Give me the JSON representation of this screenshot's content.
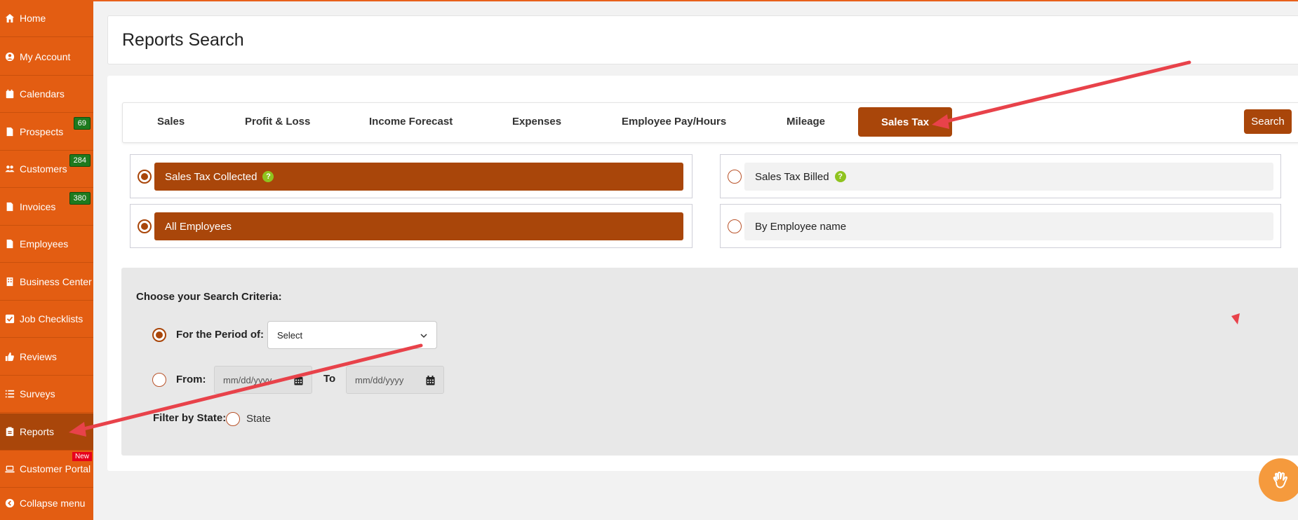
{
  "sidebar": {
    "items": [
      {
        "label": "Home",
        "icon": "home-icon"
      },
      {
        "label": "My Account",
        "icon": "user-circle-icon"
      },
      {
        "label": "Calendars",
        "icon": "calendar-icon"
      },
      {
        "label": "Prospects",
        "icon": "file-icon",
        "badge": "69"
      },
      {
        "label": "Customers",
        "icon": "users-icon",
        "badge": "284"
      },
      {
        "label": "Invoices",
        "icon": "file-icon",
        "badge": "380"
      },
      {
        "label": "Employees",
        "icon": "file-icon"
      },
      {
        "label": "Business Center",
        "icon": "building-icon"
      },
      {
        "label": "Job Checklists",
        "icon": "checkbox-icon"
      },
      {
        "label": "Reviews",
        "icon": "thumbs-up-icon"
      },
      {
        "label": "Surveys",
        "icon": "list-icon"
      },
      {
        "label": "Reports",
        "icon": "clipboard-icon"
      },
      {
        "label": "Customer Portal",
        "icon": "laptop-icon",
        "badge": "New"
      },
      {
        "label": "Collapse menu",
        "icon": "chevron-left-icon"
      }
    ],
    "active": "Reports"
  },
  "header": {
    "title": "Reports Search"
  },
  "tabs": [
    "Sales",
    "Profit & Loss",
    "Income Forecast",
    "Expenses",
    "Employee Pay/Hours",
    "Mileage",
    "Sales Tax"
  ],
  "active_tab": "Sales Tax",
  "search_label": "Search",
  "options": {
    "sales_tax_collected": "Sales Tax Collected",
    "sales_tax_billed": "Sales Tax Billed",
    "all_employees": "All Employees",
    "by_employee_name": "By Employee name"
  },
  "criteria": {
    "title": "Choose your Search Criteria:",
    "period_label": "For the Period of:",
    "period_value": "Select",
    "from_label": "From:",
    "from_placeholder": "mm/dd/yyyy",
    "to_label": "To",
    "to_placeholder": "mm/dd/yyyy",
    "filter_state_label": "Filter by State:",
    "state_label": "State"
  },
  "colors": {
    "sidebar": "#e35d12",
    "accent": "#a9460a",
    "badge": "#1e7a1e",
    "new_badge": "#e8001c",
    "annotation_arrow": "#e8424a"
  }
}
